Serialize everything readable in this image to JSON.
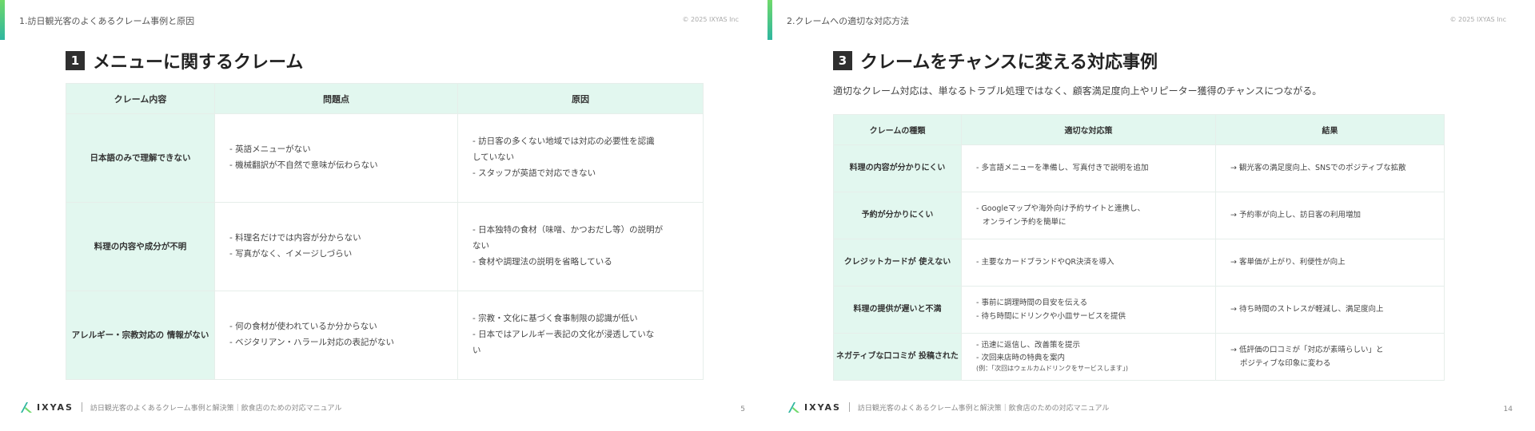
{
  "slides": [
    {
      "header_label": "1.訪日観光客のよくあるクレーム事例と原因",
      "copyright": "© 2025 IXYAS Inc",
      "title_num": "1",
      "title": "メニューに関するクレーム",
      "table": {
        "headers": [
          "クレーム内容",
          "問題点",
          "原因"
        ],
        "rows": [
          {
            "head": [
              "日本語のみで理解できない"
            ],
            "col2": [
              "- 英語メニューがない",
              "- 機械翻訳が不自然で意味が伝わらない"
            ],
            "col3": [
              "- 訪日客の多くない地域では対応の必要性を認識",
              "していない",
              "- スタッフが英語で対応できない"
            ]
          },
          {
            "head": [
              "料理の内容や成分が不明"
            ],
            "col2": [
              "- 料理名だけでは内容が分からない",
              "- 写真がなく、イメージしづらい"
            ],
            "col3": [
              "- 日本独特の食材（味噌、かつおだし等）の説明が",
              "ない",
              "- 食材や調理法の説明を省略している"
            ]
          },
          {
            "head": [
              "アレルギー・宗教対応の",
              "情報がない"
            ],
            "col2": [
              "- 何の食材が使われているか分からない",
              "- ベジタリアン・ハラール対応の表記がない"
            ],
            "col3": [
              "- 宗教・文化に基づく食事制限の認識が低い",
              "- 日本ではアレルギー表記の文化が浸透していな",
              "い"
            ]
          }
        ]
      },
      "footer_logo": "IXYAS",
      "footer_text": "訪日観光客のよくあるクレーム事例と解決策｜飲食店のための対応マニュアル",
      "page_num": "5"
    },
    {
      "header_label": "2.クレームへの適切な対応方法",
      "copyright": "© 2025 IXYAS Inc",
      "title_num": "3",
      "title": "クレームをチャンスに変える対応事例",
      "subtitle": "適切なクレーム対応は、単なるトラブル処理ではなく、顧客満足度向上やリピーター獲得のチャンスにつながる。",
      "table": {
        "headers": [
          "クレームの種類",
          "適切な対応策",
          "結果"
        ],
        "rows": [
          {
            "head": [
              "料理の内容が分かりにくい"
            ],
            "col2": [
              "- 多言語メニューを準備し、写真付きで説明を追加"
            ],
            "col3": [
              "→ 観光客の満足度向上、SNSでのポジティブな拡散"
            ]
          },
          {
            "head": [
              "予約が分かりにくい"
            ],
            "col2": [
              "- Googleマップや海外向け予約サイトと連携し、",
              "オンライン予約を簡単に"
            ],
            "col3": [
              "→ 予約率が向上し、訪日客の利用増加"
            ]
          },
          {
            "head": [
              "クレジットカードが",
              "使えない"
            ],
            "col2": [
              "- 主要なカードブランドやQR決済を導入"
            ],
            "col3": [
              "→ 客単価が上がり、利便性が向上"
            ]
          },
          {
            "head": [
              "料理の提供が遅いと不満"
            ],
            "col2": [
              "- 事前に調理時間の目安を伝える",
              "- 待ち時間にドリンクや小皿サービスを提供"
            ],
            "col3": [
              "→ 待ち時間のストレスが軽減し、満足度向上"
            ]
          },
          {
            "head": [
              "ネガティブな口コミが",
              "投稿された"
            ],
            "col2": [
              "- 迅速に返信し、改善策を提示",
              "- 次回来店時の特典を案内"
            ],
            "col2_small": "(例：「次回はウェルカムドリンクをサービスします」)",
            "col3": [
              "→ 低評価の口コミが「対応が素晴らしい」と",
              "ポジティブな印象に変わる"
            ]
          }
        ]
      },
      "footer_logo": "IXYAS",
      "footer_text": "訪日観光客のよくあるクレーム事例と解決策｜飲食店のための対応マニュアル",
      "page_num": "14"
    }
  ]
}
